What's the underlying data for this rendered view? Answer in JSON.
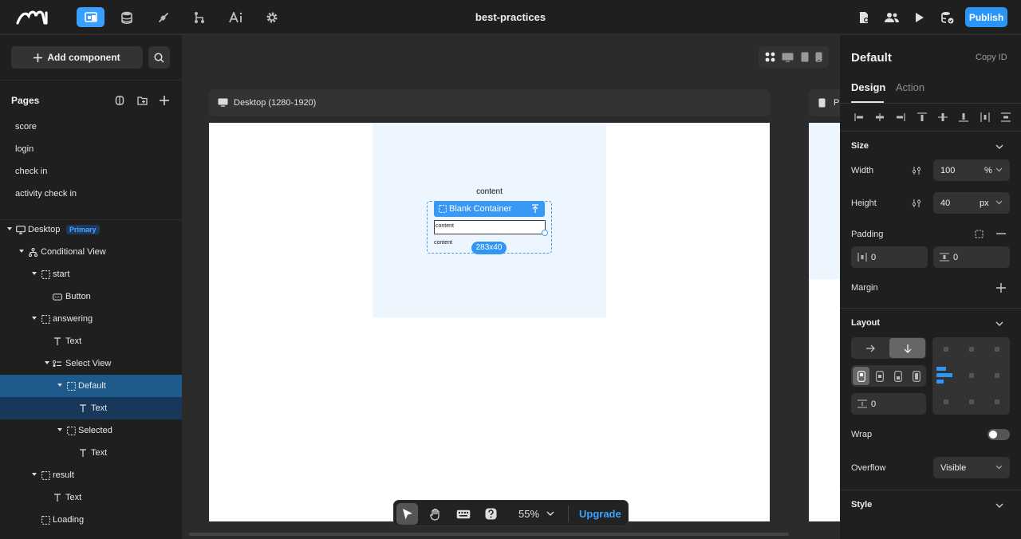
{
  "topbar": {
    "project_title": "best-practices",
    "publish_label": "Publish"
  },
  "left": {
    "add_component_label": "Add component",
    "pages_title": "Pages",
    "pages": [
      "score",
      "login",
      "check in",
      "activity check in"
    ],
    "tree": {
      "desktop": "Desktop",
      "primary_badge": "Primary",
      "conditional_view": "Conditional View",
      "start": "start",
      "button": "Button",
      "answering": "answering",
      "text_1": "Text",
      "select_view": "Select View",
      "default": "Default",
      "text_2": "Text",
      "selected": "Selected",
      "text_3": "Text",
      "result": "result",
      "text_4": "Text",
      "loading": "Loading"
    }
  },
  "canvas": {
    "frame_label": "Desktop (1280-1920)",
    "frame2_label": "P",
    "content_top": "content",
    "selection_tag": "Blank Container",
    "inner_content_1": "content",
    "inner_content_2": "content",
    "dimension_badge": "283x40",
    "zoom": "55%",
    "upgrade_label": "Upgrade"
  },
  "right": {
    "title": "Default",
    "copy_id": "Copy ID",
    "tab_design": "Design",
    "tab_action": "Action",
    "size": {
      "title": "Size",
      "width_label": "Width",
      "width_value": "100",
      "width_unit": "%",
      "height_label": "Height",
      "height_value": "40",
      "height_unit": "px"
    },
    "padding": {
      "label": "Padding",
      "horizontal": "0",
      "vertical": "0"
    },
    "margin_label": "Margin",
    "layout": {
      "title": "Layout",
      "gap_value": "0",
      "wrap_label": "Wrap",
      "overflow_label": "Overflow",
      "overflow_value": "Visible"
    },
    "style_title": "Style"
  },
  "colors": {
    "accent": "#2a95f5",
    "selected_row": "#1e5a8c",
    "canvas_bg": "#2b2b2b",
    "panel_bg": "#1f1f1f"
  }
}
